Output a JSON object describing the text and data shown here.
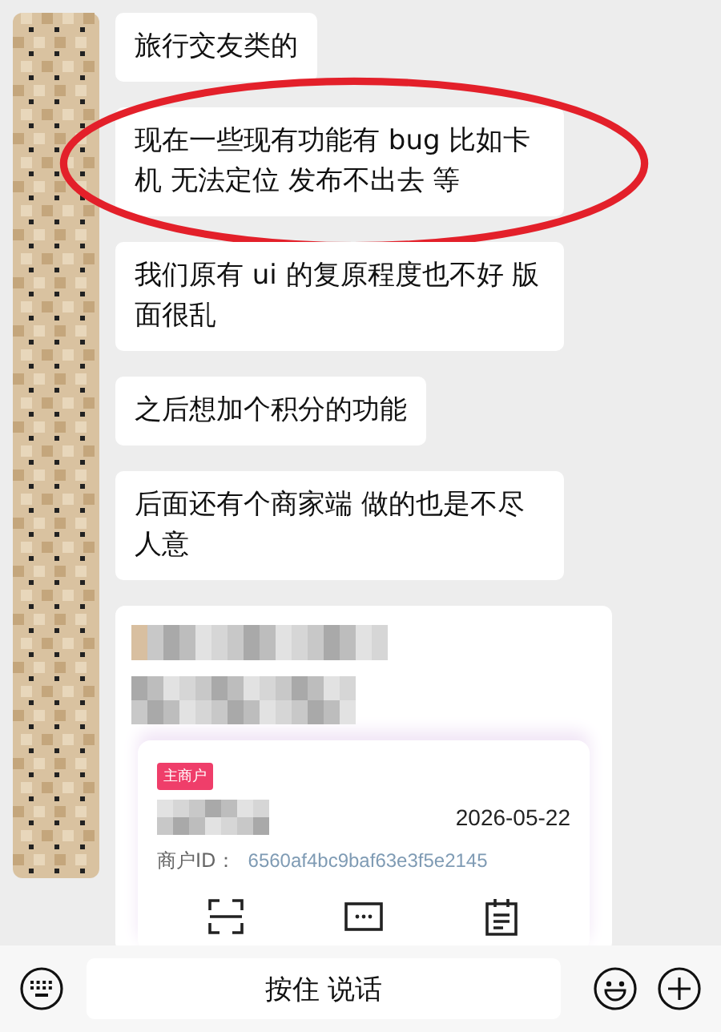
{
  "messages": [
    {
      "text": "旅行交友类的",
      "highlighted": false
    },
    {
      "text": "现在一些现有功能有 bug 比如卡机 无法定位 发布不出去 等",
      "highlighted": true
    },
    {
      "text": "我们原有 ui 的复原程度也不好 版面很乱",
      "highlighted": false
    },
    {
      "text": "之后想加个积分的功能",
      "highlighted": false
    },
    {
      "text": "后面还有个商家端 做的也是不尽人意",
      "highlighted": false
    }
  ],
  "shared_card": {
    "tag": "主商户",
    "date": "2026-05-22",
    "id_label": "商户ID：",
    "id_value": "6560af4bc9baf63e3f5e2145",
    "actions": [
      {
        "kind": "scan"
      },
      {
        "kind": "code"
      },
      {
        "kind": "records"
      }
    ]
  },
  "input_bar": {
    "voice_button": "按住 说话"
  }
}
